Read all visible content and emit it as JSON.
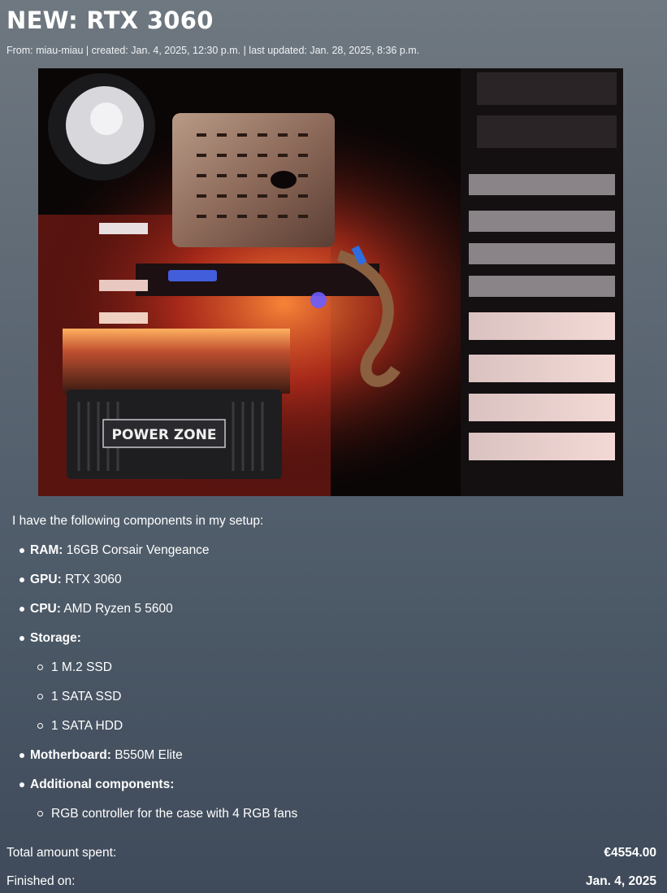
{
  "post": {
    "title": "NEW: RTX 3060",
    "meta": "From: miau-miau | created: Jan. 4, 2025, 12:30 p.m. | last updated: Jan. 28, 2025, 8:36 p.m."
  },
  "photo": {
    "label": "POWER ZONE"
  },
  "content": {
    "intro": "I have the following components in my setup:",
    "specs": [
      {
        "label": "RAM:",
        "value": "16GB Corsair Vengeance"
      },
      {
        "label": "GPU:",
        "value": "RTX 3060"
      },
      {
        "label": "CPU:",
        "value": "AMD Ryzen 5 5600"
      },
      {
        "label": "Storage:",
        "value": "",
        "sub": [
          "1 M.2 SSD",
          "1 SATA SSD",
          "1 SATA HDD"
        ]
      },
      {
        "label": "Motherboard:",
        "value": "B550M Elite"
      },
      {
        "label": "Additional components:",
        "value": "",
        "sub": [
          "RGB controller for the case with 4 RGB fans"
        ]
      }
    ]
  },
  "summary": {
    "total_label": "Total amount spent:",
    "total_value": "€4554.00",
    "finished_label": "Finished on:",
    "finished_value": "Jan. 4, 2025"
  }
}
